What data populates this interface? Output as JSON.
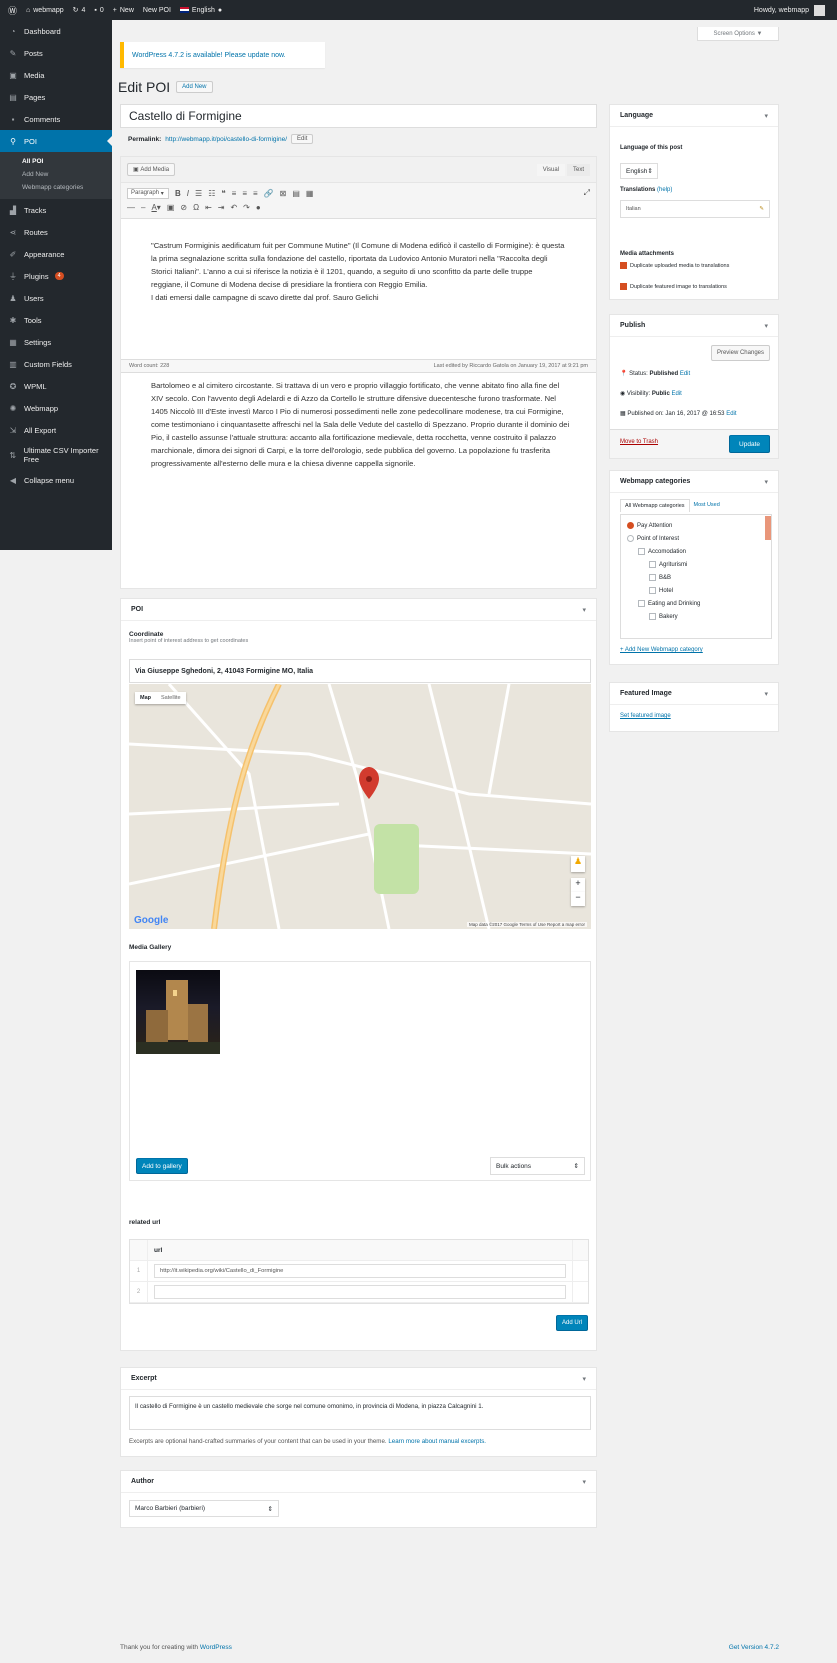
{
  "adminbar": {
    "site_name": "webmapp",
    "updates_count": "4",
    "comments_count": "0",
    "new_label": "New",
    "new_poi_label": "New POI",
    "language_label": "English",
    "howdy": "Howdy, webmapp"
  },
  "sidebar": {
    "items": [
      {
        "label": "Dashboard",
        "icon": "gauge-icon"
      },
      {
        "label": "Posts",
        "icon": "pin-icon"
      },
      {
        "label": "Media",
        "icon": "media-icon"
      },
      {
        "label": "Pages",
        "icon": "page-icon"
      },
      {
        "label": "Comments",
        "icon": "comment-icon"
      },
      {
        "label": "POI",
        "icon": "location-icon"
      },
      {
        "label": "Tracks",
        "icon": "chart-icon"
      },
      {
        "label": "Routes",
        "icon": "share-icon"
      },
      {
        "label": "Appearance",
        "icon": "brush-icon"
      },
      {
        "label": "Plugins",
        "icon": "plugin-icon",
        "badge": "4"
      },
      {
        "label": "Users",
        "icon": "user-icon"
      },
      {
        "label": "Tools",
        "icon": "wrench-icon"
      },
      {
        "label": "Settings",
        "icon": "settings-icon"
      },
      {
        "label": "Custom Fields",
        "icon": "grid-icon"
      },
      {
        "label": "WPML",
        "icon": "wpml-icon"
      },
      {
        "label": "Webmapp",
        "icon": "gear-icon"
      },
      {
        "label": "All Export",
        "icon": "export-icon"
      },
      {
        "label": "Ultimate CSV Importer Free",
        "icon": "csv-icon"
      },
      {
        "label": "Collapse menu",
        "icon": "collapse-icon"
      }
    ],
    "poi_sub": [
      "All POI",
      "Add New",
      "Webmapp categories"
    ]
  },
  "notice": {
    "text": "WordPress 4.7.2 is available!",
    "link": "Please update now."
  },
  "screen_options": "Screen Options ▼",
  "page_title": "Edit POI",
  "add_new": "Add New",
  "post_title": "Castello di Formigine",
  "permalink": {
    "label": "Permalink:",
    "url": "http://webmapp.it/poi/castello-di-formigine/",
    "edit": "Edit"
  },
  "editor": {
    "add_media": "Add Media",
    "tab_visual": "Visual",
    "tab_text": "Text",
    "paragraph": "Paragraph",
    "para1": "\"Castrum Formiginis aedificatum fuit per Commune Mutine\" (Il Comune di Modena edificò il castello di Formigine): è questa la prima segnalazione scritta sulla fondazione del castello, riportata da Ludovico Antonio Muratori nella \"Raccolta degli Storici Italiani\". L'anno a cui si riferisce la notizia è il 1201, quando, a seguito di uno sconfitto da parte delle truppe reggiane, il Comune di Modena decise di presidiare la frontiera con Reggio Emilia.",
    "para1_tail": "I dati emersi dalle campagne di scavo dirette dal prof. Sauro Gelichi",
    "word_count": "Word count: 228",
    "last_edited": "Last edited by Riccardo Gatola on January 19, 2017 at 9:21 pm",
    "para2": "Bartolomeo e al cimitero circostante. Si trattava di un vero e proprio villaggio fortificato, che venne abitato fino alla fine del XIV secolo. Con l'avvento degli Adelardi e di Azzo da Cortello le strutture difensive duecentesche furono trasformate. Nel 1405 Niccolò III d'Este investì Marco I Pio di numerosi possedimenti nelle zone pedecollinare modenese, tra cui Formigine, come testimoniano i cinquantasette affreschi nel la Sala delle Vedute del castello di Spezzano. Proprio durante il dominio dei Pio, il castello assunse l'attuale struttura: accanto alla fortificazione medievale, detta rocchetta, venne costruito il palazzo marchionale, dimora dei signori di Carpi, e la torre dell'orologio, sede pubblica del governo. La popolazione fu trasferita progressivamente all'esterno delle mura e la chiesa divenne cappella signorile."
  },
  "poi_box": {
    "title": "POI",
    "coord_label": "Coordinate",
    "coord_help": "Insert point of interest address to get coordinates",
    "address": "Via Giuseppe Sghedoni, 2, 41043 Formigine MO, Italia",
    "map_btn": "Map",
    "sat_btn": "Satellite",
    "google": "Google",
    "map_attrib": "Map data ©2017 Google   Terms of Use   Report a map error",
    "gallery_label": "Media Gallery",
    "add_gallery": "Add to gallery",
    "bulk_actions": "Bulk actions",
    "related_label": "related url",
    "url_col": "url",
    "rows": [
      {
        "num": "1",
        "value": "http://it.wikipedia.org/wiki/Castello_di_Formigine"
      },
      {
        "num": "2",
        "value": ""
      }
    ],
    "add_row": "Add Url"
  },
  "excerpt": {
    "title": "Excerpt",
    "text": "Il castello di Formigine è un castello medievale che sorge nel comune omonimo, in provincia di Modena, in piazza Calcagnini 1.",
    "help": "Excerpts are optional hand-crafted summaries of your content that can be used in your theme.",
    "help_link": "Learn more about manual excerpts."
  },
  "author": {
    "title": "Author",
    "value": "Marco Barbieri (barbieri)"
  },
  "language_box": {
    "title": "Language",
    "lang_label": "Language of this post",
    "lang_value": "English",
    "translations_label": "Translations",
    "translations_help": "(help)",
    "translation_value": "Italian",
    "media_label": "Media attachments",
    "media_opt1": "Duplicate uploaded media to translations",
    "media_opt2": "Duplicate featured image to translations"
  },
  "publish_box": {
    "title": "Publish",
    "preview": "Preview Changes",
    "status_label": "Status:",
    "status_value": "Published",
    "visibility_label": "Visibility:",
    "visibility_value": "Public",
    "published_on": "Published on: Jan 16, 2017 @ 16:53",
    "edit": "Edit",
    "trash": "Move to Trash",
    "update": "Update"
  },
  "categories_box": {
    "title": "Webmapp categories",
    "tab_all": "All Webmapp categories",
    "tab_most": "Most Used",
    "items": [
      {
        "label": "Pay Attention",
        "checked": true,
        "level": 0
      },
      {
        "label": "Point of Interest",
        "checked": false,
        "level": 0
      },
      {
        "label": "Accomodation",
        "checked": false,
        "level": 1
      },
      {
        "label": "Agriturismi",
        "checked": false,
        "level": 2
      },
      {
        "label": "B&B",
        "checked": false,
        "level": 2
      },
      {
        "label": "Hotel",
        "checked": false,
        "level": 2
      },
      {
        "label": "Eating and Drinking",
        "checked": false,
        "level": 1
      },
      {
        "label": "Bakery",
        "checked": false,
        "level": 2
      }
    ],
    "add_new": "+ Add New Webmapp category"
  },
  "featured_box": {
    "title": "Featured Image",
    "link": "Set featured image"
  },
  "footer": {
    "thanks": "Thank you for creating with",
    "wp": "WordPress",
    "version": "Get Version 4.7.2"
  },
  "colors": {
    "accent": "#0073aa",
    "sidebar": "#23282d",
    "badge": "#d54e21"
  }
}
